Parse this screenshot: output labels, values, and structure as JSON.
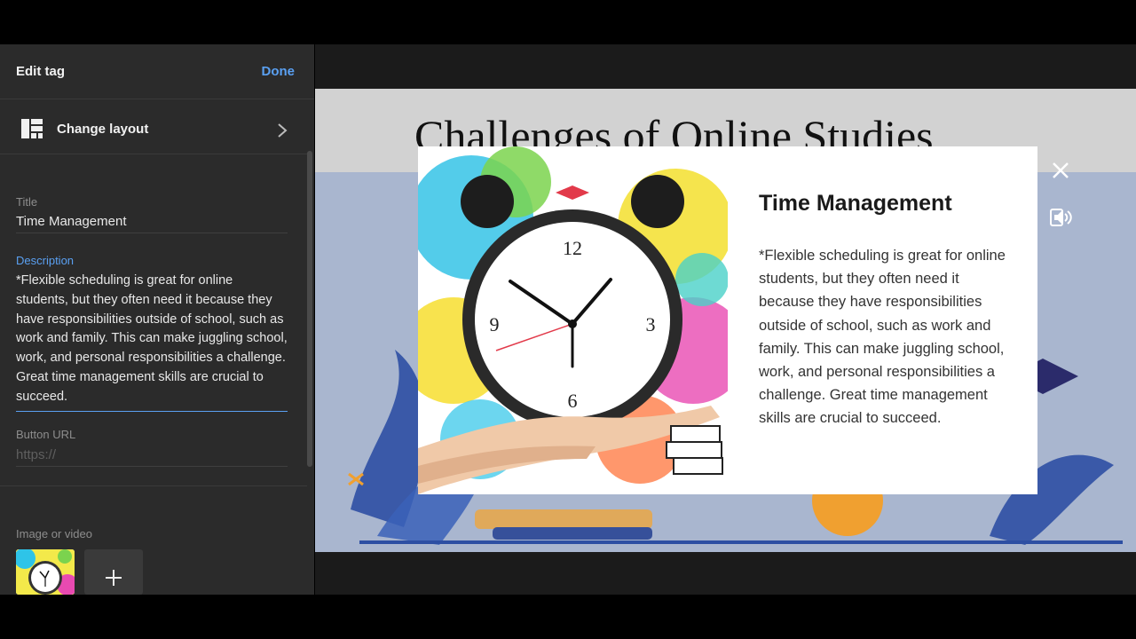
{
  "panel": {
    "title": "Edit tag",
    "done_label": "Done",
    "change_layout_label": "Change layout",
    "title_field": {
      "label": "Title",
      "value": "Time Management"
    },
    "description_field": {
      "label": "Description",
      "value": "*Flexible scheduling is great for online students, but they often need it because they have responsibilities outside of school, such as work and family. This can make juggling school, work, and personal responsibilities a challenge. Great time management skills are crucial to succeed."
    },
    "button_url_field": {
      "label": "Button URL",
      "placeholder": "https://"
    },
    "media_section": {
      "label": "Image or video"
    }
  },
  "slide": {
    "title": "Challenges of Online Studies"
  },
  "modal": {
    "title": "Time Management",
    "description": "*Flexible scheduling is great for online students, but they often need it because they have responsibilities outside of school, such as work and family. This can make juggling school, work, and personal responsibilities a challenge. Great time management skills are crucial to succeed.",
    "clock_numbers": [
      "12",
      "3",
      "6",
      "9"
    ]
  },
  "colors": {
    "accent": "#5aa0f2",
    "panel_bg": "#2b2b2b",
    "slide_bg": "#a9b6cf"
  },
  "icons": [
    "layout-icon",
    "chevron-right-icon",
    "close-icon",
    "audio-icon",
    "plus-icon"
  ]
}
